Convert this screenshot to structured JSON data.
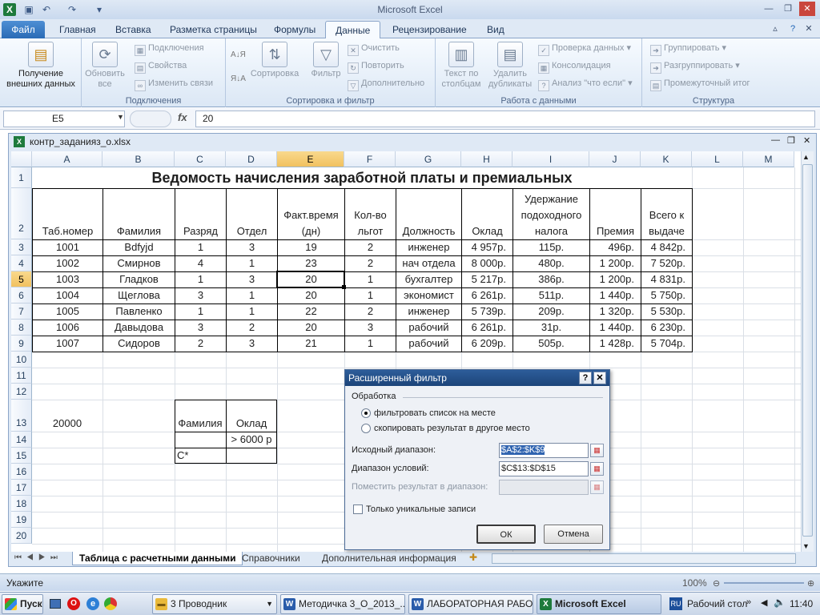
{
  "app": {
    "title": "Microsoft Excel"
  },
  "ribbon": {
    "tabs": [
      "Файл",
      "Главная",
      "Вставка",
      "Разметка страницы",
      "Формулы",
      "Данные",
      "Рецензирование",
      "Вид"
    ],
    "active_tab": "Данные",
    "groups": {
      "get_data": {
        "button": "Получение внешних данных"
      },
      "connections": {
        "label": "Подключения",
        "refresh": "Обновить все",
        "items": [
          "Подключения",
          "Свойства",
          "Изменить связи"
        ]
      },
      "sort_filter": {
        "label": "Сортировка и фильтр",
        "sort": "Сортировка",
        "filter": "Фильтр",
        "items": [
          "Очистить",
          "Повторить",
          "Дополнительно"
        ]
      },
      "data_tools": {
        "label": "Работа с данными",
        "text_to_cols": "Текст по столбцам",
        "remove_dup": "Удалить дубликаты",
        "items": [
          "Проверка данных",
          "Консолидация",
          "Анализ \"что если\""
        ]
      },
      "outline": {
        "label": "Структура",
        "items": [
          "Группировать",
          "Разгруппировать",
          "Промежуточный итог"
        ]
      }
    }
  },
  "formula_bar": {
    "name_box": "E5",
    "fx": "fx",
    "value": "20"
  },
  "workbook": {
    "title": "контр_заданияз_о.xlsx"
  },
  "sheet": {
    "columns": [
      "A",
      "B",
      "C",
      "D",
      "E",
      "F",
      "G",
      "H",
      "I",
      "J",
      "K",
      "L",
      "M"
    ],
    "rows": [
      "1",
      "2",
      "3",
      "4",
      "5",
      "6",
      "7",
      "8",
      "9",
      "10",
      "11",
      "12",
      "13",
      "14",
      "15",
      "16",
      "17",
      "18",
      "19",
      "20"
    ],
    "title": "Ведомость начисления заработной платы и премиальных",
    "headers": [
      "Таб.номер",
      "Фамилия",
      "Разряд",
      "Отдел",
      "Факт.время (дн)",
      "Кол-во льгот",
      "Должность",
      "Оклад",
      "Удержание подоходного налога",
      "Премия",
      "Всего к выдаче"
    ],
    "data": [
      [
        "1001",
        "Bdfyjd",
        "1",
        "3",
        "19",
        "2",
        "инженер",
        "4 957р.",
        "115р.",
        "496р.",
        "4 842р."
      ],
      [
        "1002",
        "Смирнов",
        "4",
        "1",
        "23",
        "2",
        "нач отдела",
        "8 000р.",
        "480р.",
        "1 200р.",
        "7 520р."
      ],
      [
        "1003",
        "Гладков",
        "1",
        "3",
        "20",
        "1",
        "бухгалтер",
        "5 217р.",
        "386р.",
        "1 200р.",
        "4 831р."
      ],
      [
        "1004",
        "Щеглова",
        "3",
        "1",
        "20",
        "1",
        "экономист",
        "6 261р.",
        "511р.",
        "1 440р.",
        "5 750р."
      ],
      [
        "1005",
        "Павленко",
        "1",
        "1",
        "22",
        "2",
        "инженер",
        "5 739р.",
        "209р.",
        "1 320р.",
        "5 530р."
      ],
      [
        "1006",
        "Давыдова",
        "3",
        "2",
        "20",
        "3",
        "рабочий",
        "6 261р.",
        "31р.",
        "1 440р.",
        "6 230р."
      ],
      [
        "1007",
        "Сидоров",
        "2",
        "3",
        "21",
        "1",
        "рабочий",
        "6 209р.",
        "505р.",
        "1 428р.",
        "5 704р."
      ]
    ],
    "a13": "20000",
    "criteria": {
      "h1": "Фамилия",
      "h2": "Оклад",
      "d14": "> 6000 р",
      "c15": "С*"
    }
  },
  "sheet_tabs": [
    "Таблица с расчетными данными",
    "Справочники",
    "Дополнительная информация"
  ],
  "status": {
    "mode": "Укажите",
    "zoom": "100%"
  },
  "dialog": {
    "title": "Расширенный фильтр",
    "help": "?",
    "close": "✕",
    "group": "Обработка",
    "opt1": "фильтровать список на месте",
    "opt2": "скопировать результат в другое место",
    "src_label": "Исходный диапазон:",
    "src_value": "$A$2:$K$9",
    "cond_label": "Диапазон условий:",
    "cond_value": "$C$13:$D$15",
    "dest_label": "Поместить результат в диапазон:",
    "unique_label": "Только уникальные записи",
    "ok": "ОК",
    "cancel": "Отмена"
  },
  "taskbar": {
    "start": "Пуск",
    "items": [
      "3 Проводник",
      "Методичка 3_О_2013_...",
      "ЛАБОРАТОРНАЯ РАБО...",
      "Microsoft Excel"
    ],
    "lang": "RU",
    "desktop": "Рабочий стол",
    "time": "11:40"
  }
}
